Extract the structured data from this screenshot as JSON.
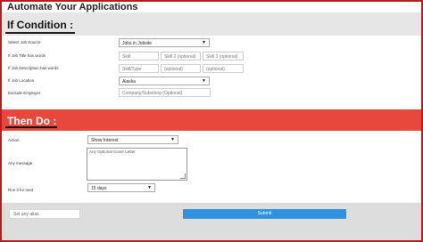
{
  "app": {
    "title": "Automate Your Applications"
  },
  "if_section": {
    "heading": "If Condition :",
    "fields": {
      "job_source": {
        "label": "Select Job Source",
        "value": "Jobs in Jobsite"
      },
      "job_title": {
        "label": "If Job Title has words",
        "skill1": "Skill",
        "skill2": "Skill 2 (optional)",
        "skill3": "Skill 3 (optional)"
      },
      "job_description": {
        "label": "If Job Description has words",
        "skill": "Skill/Type",
        "optional1": "(optional)",
        "optional2": "(optional)"
      },
      "job_location": {
        "label": "If Job Location",
        "value": "Alaska"
      },
      "exclude_employer": {
        "label": "Exclude Employer",
        "placeholder": "Company/Substring (Optional)"
      }
    }
  },
  "then_section": {
    "heading": "Then Do :",
    "fields": {
      "action": {
        "label": "Action",
        "value": "Show Interest"
      },
      "message": {
        "label": "Any message",
        "placeholder": "Any Optional Cover Letter"
      },
      "run_for_next": {
        "label": "Run it for next",
        "value": "15 days"
      }
    }
  },
  "footer": {
    "alias_placeholder": "Set any alias",
    "submit_label": "Submit"
  },
  "colors": {
    "accent_red": "#e8483c",
    "submit_blue": "#2f92df",
    "frame_red": "#b51d1d"
  },
  "icons": [
    "chevron-down-icon",
    "resize-grip-icon"
  ]
}
